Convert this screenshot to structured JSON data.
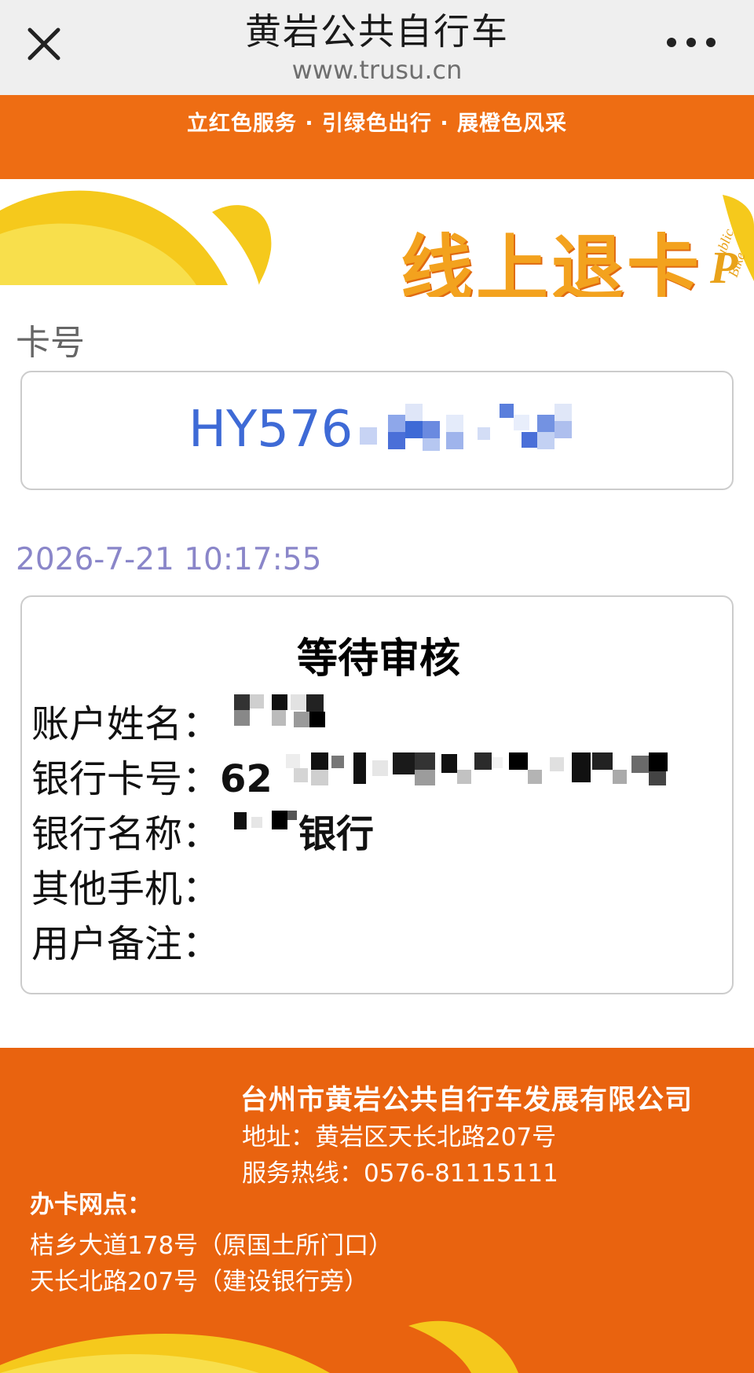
{
  "nav": {
    "title": "黄岩公共自行车",
    "url": "www.trusu.cn",
    "close_icon": "close-icon",
    "more_icon": "more-icon"
  },
  "banner": {
    "slogan": "立红色服务 · 引绿色出行 · 展橙色风采"
  },
  "hero": {
    "title": "线上退卡",
    "logo_text": "Public Bike"
  },
  "card": {
    "label": "卡号",
    "number_visible": "HY576"
  },
  "timestamp": "2026-7-21 10:17:55",
  "status": {
    "title": "等待审核",
    "rows": [
      {
        "label": "账户姓名：",
        "value": ""
      },
      {
        "label": "银行卡号：",
        "value": "62"
      },
      {
        "label": "银行名称：",
        "value": "银行"
      },
      {
        "label": "其他手机：",
        "value": ""
      },
      {
        "label": "用户备注：",
        "value": ""
      }
    ]
  },
  "footer": {
    "company": "台州市黄岩公共自行车发展有限公司",
    "address": "地址：黄岩区天长北路207号",
    "hotline": "服务热线：0576-81115111",
    "outlets_title": "办卡网点：",
    "outlets": [
      "桔乡大道178号（原国土所门口）",
      "天长北路207号（建设银行旁）"
    ]
  },
  "colors": {
    "orange": "#ee6d13",
    "footer_orange": "#e9630f",
    "yellow": "#f5c91c",
    "card_blue": "#3e6ad6",
    "time_purple": "#8a86c9"
  }
}
